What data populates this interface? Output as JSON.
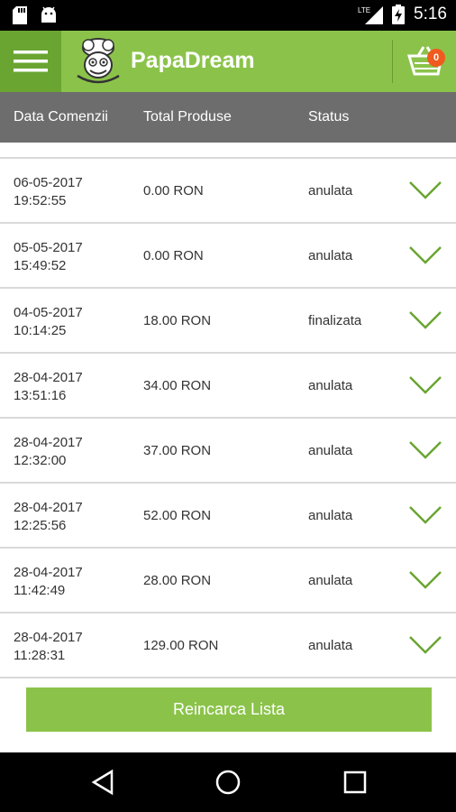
{
  "status_bar": {
    "time": "5:16",
    "network": "LTE"
  },
  "app": {
    "title": "PapaDream",
    "cart_count": "0",
    "accent": "#8bc34a"
  },
  "table": {
    "headers": [
      "Data Comenzii",
      "Total Produse",
      "Status"
    ],
    "rows": [
      {
        "date": "06-05-2017",
        "time": "19:52:55",
        "total": "0.00 RON",
        "status": "anulata"
      },
      {
        "date": "05-05-2017",
        "time": "15:49:52",
        "total": "0.00 RON",
        "status": "anulata"
      },
      {
        "date": "04-05-2017",
        "time": "10:14:25",
        "total": "18.00 RON",
        "status": "finalizata"
      },
      {
        "date": "28-04-2017",
        "time": "13:51:16",
        "total": "34.00 RON",
        "status": "anulata"
      },
      {
        "date": "28-04-2017",
        "time": "12:32:00",
        "total": "37.00 RON",
        "status": "anulata"
      },
      {
        "date": "28-04-2017",
        "time": "12:25:56",
        "total": "52.00 RON",
        "status": "anulata"
      },
      {
        "date": "28-04-2017",
        "time": "11:42:49",
        "total": "28.00 RON",
        "status": "anulata"
      },
      {
        "date": "28-04-2017",
        "time": "11:28:31",
        "total": "129.00 RON",
        "status": "anulata"
      }
    ]
  },
  "reload_button": {
    "label": "Reincarca Lista"
  }
}
